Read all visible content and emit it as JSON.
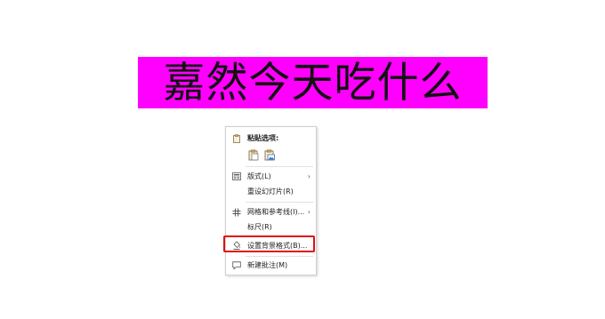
{
  "slide": {
    "title": "嘉然今天吃什么",
    "title_bg_color": "#ff00ff"
  },
  "context_menu": {
    "paste_header": "粘贴选项:",
    "paste_options": [
      "paste-icon",
      "paste-picture-icon"
    ],
    "items": [
      {
        "label": "版式(L)",
        "icon": "layout-icon",
        "submenu": true
      },
      {
        "label": "重设幻灯片(R)",
        "icon": "",
        "submenu": false
      },
      {
        "label": "网格和参考线(I)...",
        "icon": "grid-icon",
        "submenu": true
      },
      {
        "label": "标尺(R)",
        "icon": "",
        "submenu": false
      },
      {
        "label": "设置背景格式(B)...",
        "icon": "background-format-icon",
        "submenu": false,
        "highlighted": true
      },
      {
        "label": "新建批注(M)",
        "icon": "comment-icon",
        "submenu": false
      }
    ],
    "highlight_color": "#e01010"
  }
}
